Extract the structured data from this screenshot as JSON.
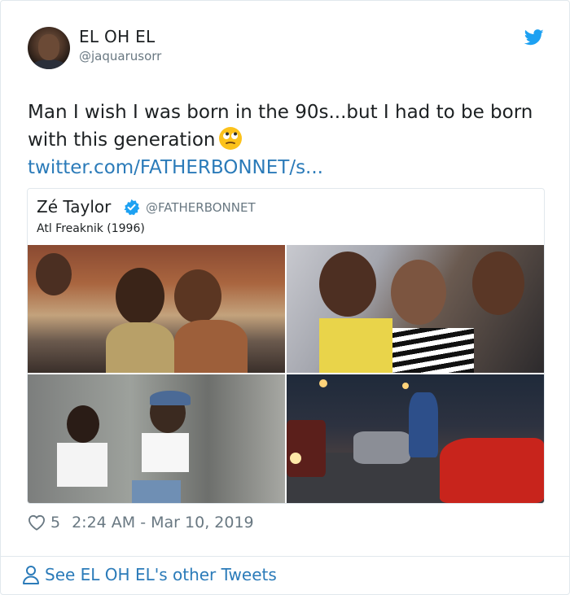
{
  "author": {
    "name": "EL OH EL",
    "handle": "@jaquarusorr"
  },
  "tweet": {
    "text": "Man I wish I was born in the 90s...but I had to be born with this generation",
    "emoji_icon": "rolling-eyes-emoji",
    "link": "twitter.com/FATHERBONNET/s..."
  },
  "quoted": {
    "name": "Zé Taylor",
    "handle": "@FATHERBONNET",
    "verified": true,
    "text": "Atl Freaknik (1996)",
    "photos": [
      "crowd-street-photo",
      "car-friends-photo",
      "dancing-women-photo",
      "night-street-cars-photo"
    ]
  },
  "meta": {
    "likes": "5",
    "timestamp": "2:24 AM - Mar 10, 2019"
  },
  "footer": {
    "label": "See EL OH EL's other Tweets"
  },
  "colors": {
    "link": "#2b7bb9",
    "secondary_text": "#697882",
    "twitter_blue": "#1da1f2",
    "border": "#e1e8ed"
  }
}
